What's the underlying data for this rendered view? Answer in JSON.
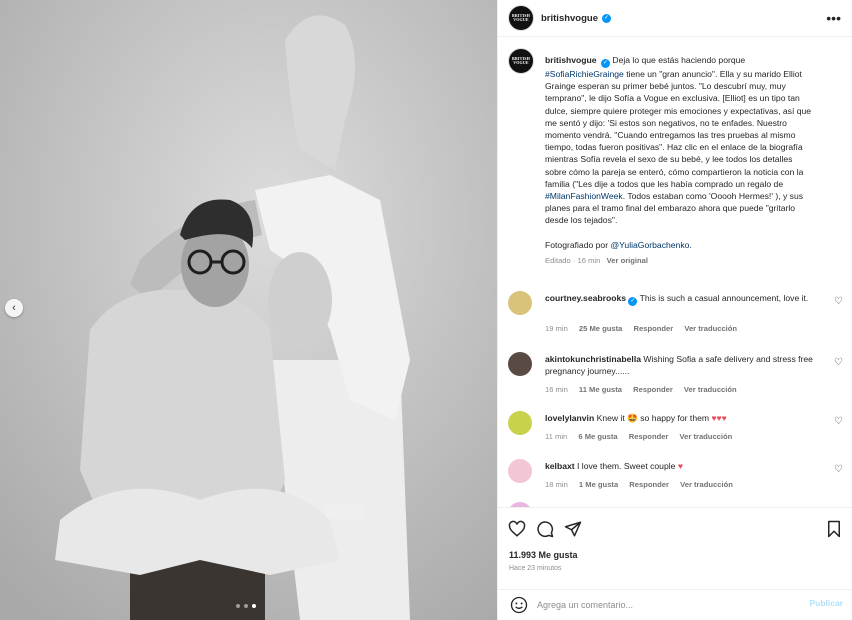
{
  "post": {
    "username": "britishvogue",
    "avatar_text": "BRITISH VOGUE",
    "more_icon": "more-horizontal-icon"
  },
  "caption": {
    "username": "britishvogue",
    "part1": "Deja lo que estás haciendo porque",
    "hashtag1": "#SofiaRichieGrainge",
    "part2": "tiene un \"gran anuncio\". Ella y su marido Elliot Grainge esperan su primer bebé juntos. \"Lo descubrí muy, muy temprano\", le dijo Sofía a Vogue en exclusiva. [Elliot] es un tipo tan dulce, siempre quiere proteger mis emociones y expectativas, así que me sentó y dijo: 'Si estos son negativos, no te enfades. Nuestro momento vendrá. \"Cuando entregamos las tres pruebas al mismo tiempo, todas fueron positivas\". Haz clic en el enlace de la biografía mientras Sofía revela el sexo de su bebé, y lee todos los detalles sobre cómo la pareja se enteró, cómo compartieron la noticia con la familia (\"Les dije a todos que les había comprado un regalo de",
    "hashtag2": "#MilanFashionWeek",
    "part3": ". Todos estaban como 'Ooooh Hermes!' ), y sus planes para el tramo final del embarazo ahora que puede \"gritarlo desde los tejados\".",
    "photo_credit_prefix": "Fotografiado por",
    "photo_credit_mention": "@YuliaGorbachenko",
    "photo_credit_suffix": ".",
    "edited": "Editado · 16 min",
    "see_translation": "Ver original"
  },
  "comments": [
    {
      "username": "courtney.seabrooks",
      "verified": true,
      "text": "This is such a casual announcement, love it.",
      "time": "19 min",
      "likes": "25 Me gusta",
      "reply": "Responder",
      "translate": "Ver traducción",
      "avatar_color": "#d9c27a"
    },
    {
      "username": "akintokunchristinabella",
      "verified": false,
      "text": "Wishing Sofia a safe delivery and stress free pregnancy journey......",
      "time": "16 min",
      "likes": "11 Me gusta",
      "reply": "Responder",
      "translate": "Ver traducción",
      "avatar_color": "#5a4a44"
    },
    {
      "username": "lovelylanvin",
      "verified": false,
      "text": "Knew it 🤩 so happy for them",
      "hearts": "♥♥♥",
      "time": "11 min",
      "likes": "6 Me gusta",
      "reply": "Responder",
      "translate": "Ver traducción",
      "avatar_color": "#c8d24a"
    },
    {
      "username": "kelbaxt",
      "verified": false,
      "text": "I love them. Sweet couple",
      "hearts": "♥",
      "time": "18 min",
      "likes": "1 Me gusta",
      "reply": "Responder",
      "translate": "Ver traducción",
      "avatar_color": "#f2c6d4"
    }
  ],
  "actions": {
    "like_icon": "heart-icon",
    "comment_icon": "comment-icon",
    "share_icon": "send-icon",
    "save_icon": "bookmark-icon",
    "likes_count": "11.993 Me gusta",
    "time_ago": "Hace 23 minutos"
  },
  "composer": {
    "placeholder": "Agrega un comentario...",
    "publish": "Publicar",
    "emoji_icon": "emoji-icon"
  },
  "carousel": {
    "prev_icon": "chevron-left-icon",
    "slide_count": 3,
    "active_index": 2
  },
  "colors": {
    "verified": "#0095f6",
    "link": "#00376b",
    "heart": "#ed4956",
    "muted": "#8e8e8e",
    "publish_disabled": "#b2dffc"
  }
}
